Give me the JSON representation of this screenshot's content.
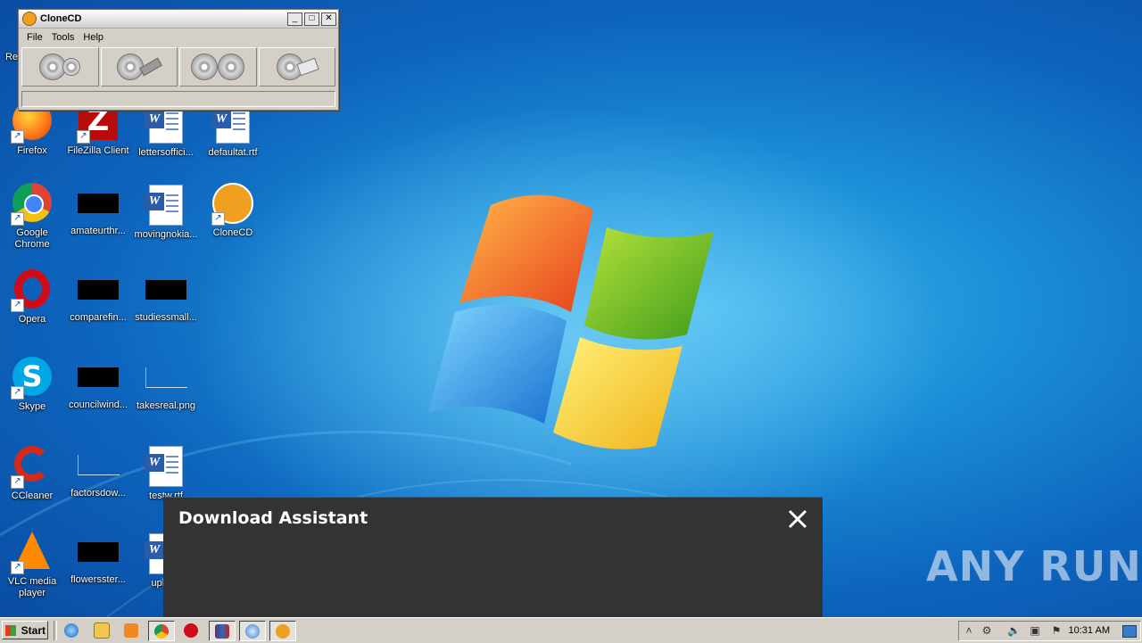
{
  "desktop": {
    "icons": [
      {
        "label": "Firefox"
      },
      {
        "label": "FileZilla Client"
      },
      {
        "label": "lettersoffici..."
      },
      {
        "label": "defaultat.rtf"
      },
      {
        "label": "Google Chrome"
      },
      {
        "label": "amateurthr..."
      },
      {
        "label": "movingnokia..."
      },
      {
        "label": "CloneCD"
      },
      {
        "label": "Opera"
      },
      {
        "label": "comparefin..."
      },
      {
        "label": "studiessmall..."
      },
      {
        "label": "Skype"
      },
      {
        "label": "councilwind..."
      },
      {
        "label": "takesreal.png"
      },
      {
        "label": "CCleaner"
      },
      {
        "label": "factorsdow..."
      },
      {
        "label": "testw.rtf"
      },
      {
        "label": "VLC media player"
      },
      {
        "label": "flowersster..."
      },
      {
        "label": "uplat..."
      }
    ],
    "partial_top_label": "Re"
  },
  "clonecd_window": {
    "title": "CloneCD",
    "menu": [
      "File",
      "Tools",
      "Help"
    ],
    "toolbar_icons": [
      "read-cd-to-image-icon",
      "write-image-to-cd-icon",
      "copy-cd-icon",
      "erase-cd-icon"
    ],
    "controls": {
      "minimize": "_",
      "maximize": "□",
      "close": "✕"
    }
  },
  "download_assistant": {
    "title": "Download Assistant",
    "close": "✕"
  },
  "watermark": {
    "text": "ANY RUN"
  },
  "taskbar": {
    "start_label": "Start",
    "clock": "10:31 AM",
    "tray_expand": "˄",
    "pinned": [
      "internet-explorer-icon",
      "explorer-icon",
      "media-player-icon",
      "chrome-icon",
      "opera-icon",
      "winrar-icon",
      "itunes-icon",
      "clonecd-icon"
    ]
  },
  "colors": {
    "dl_bg": "#333333",
    "taskbar": "#d4d0c8",
    "desktop_blue": "#1c8fd8"
  }
}
